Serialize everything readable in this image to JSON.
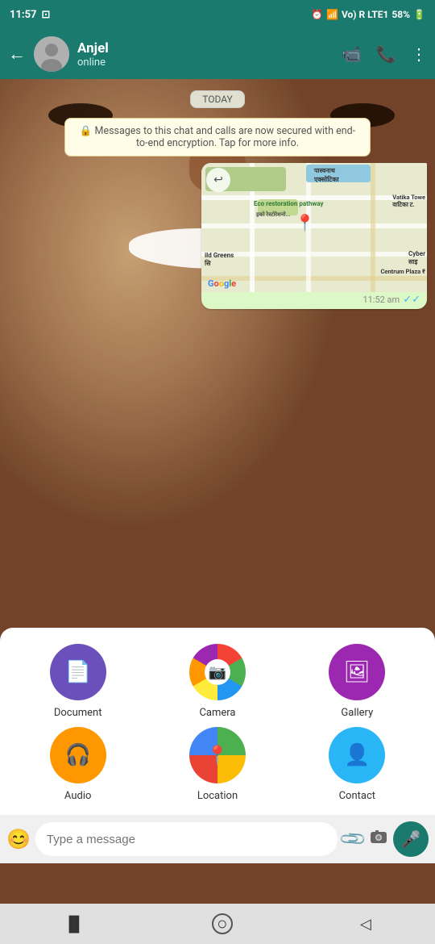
{
  "statusBar": {
    "time": "11:57",
    "battery": "58%",
    "signal": "Vo) R LTE1"
  },
  "header": {
    "contactName": "Anjel",
    "status": "online",
    "backLabel": "←",
    "videoCallLabel": "📹",
    "callLabel": "📞",
    "menuLabel": "⋮"
  },
  "chat": {
    "dateBadge": "TODAY",
    "encryptionMessage": "🔒 Messages to this chat and calls are now secured with end-to-end encryption. Tap for more info.",
    "mapMessage": {
      "time": "11:52 am",
      "ticks": "✓✓",
      "mapLabels": {
        "hindi1": "पास्वनाथ एक्सोटिका",
        "ecoLabel": "Eco restoration pathway",
        "hindi2": "इको रेस्टोरेशनो...",
        "vatikaLabel": "Vatika Towe वाटिका ट.",
        "greensLabel": "ild Greens सि",
        "cyberLabel": "Cyber साइ",
        "centrumLabel": "Centrum Plaza ₹"
      },
      "forwardIcon": "↩"
    }
  },
  "attachPanel": {
    "items": [
      {
        "id": "document",
        "label": "Document",
        "color": "#6B4FBB",
        "icon": "📄"
      },
      {
        "id": "camera",
        "label": "Camera",
        "color": "#FF9800",
        "icon": "📷",
        "isColorWheel": true
      },
      {
        "id": "gallery",
        "label": "Gallery",
        "color": "#9C27B0",
        "icon": "🖼"
      },
      {
        "id": "audio",
        "label": "Audio",
        "color": "#FF9800",
        "icon": "🎧"
      },
      {
        "id": "location",
        "label": "Location",
        "color": "#4CAF50",
        "icon": "📍"
      },
      {
        "id": "contact",
        "label": "Contact",
        "color": "#29B6F6",
        "icon": "👤"
      }
    ]
  },
  "inputBar": {
    "placeholder": "Type a message",
    "emojiIcon": "😊",
    "attachIcon": "📎",
    "cameraIcon": "📷",
    "micIcon": "🎤"
  },
  "sysNav": {
    "backBtn": "◁",
    "homeBtn": "○",
    "recentBtn": "▐▌"
  }
}
